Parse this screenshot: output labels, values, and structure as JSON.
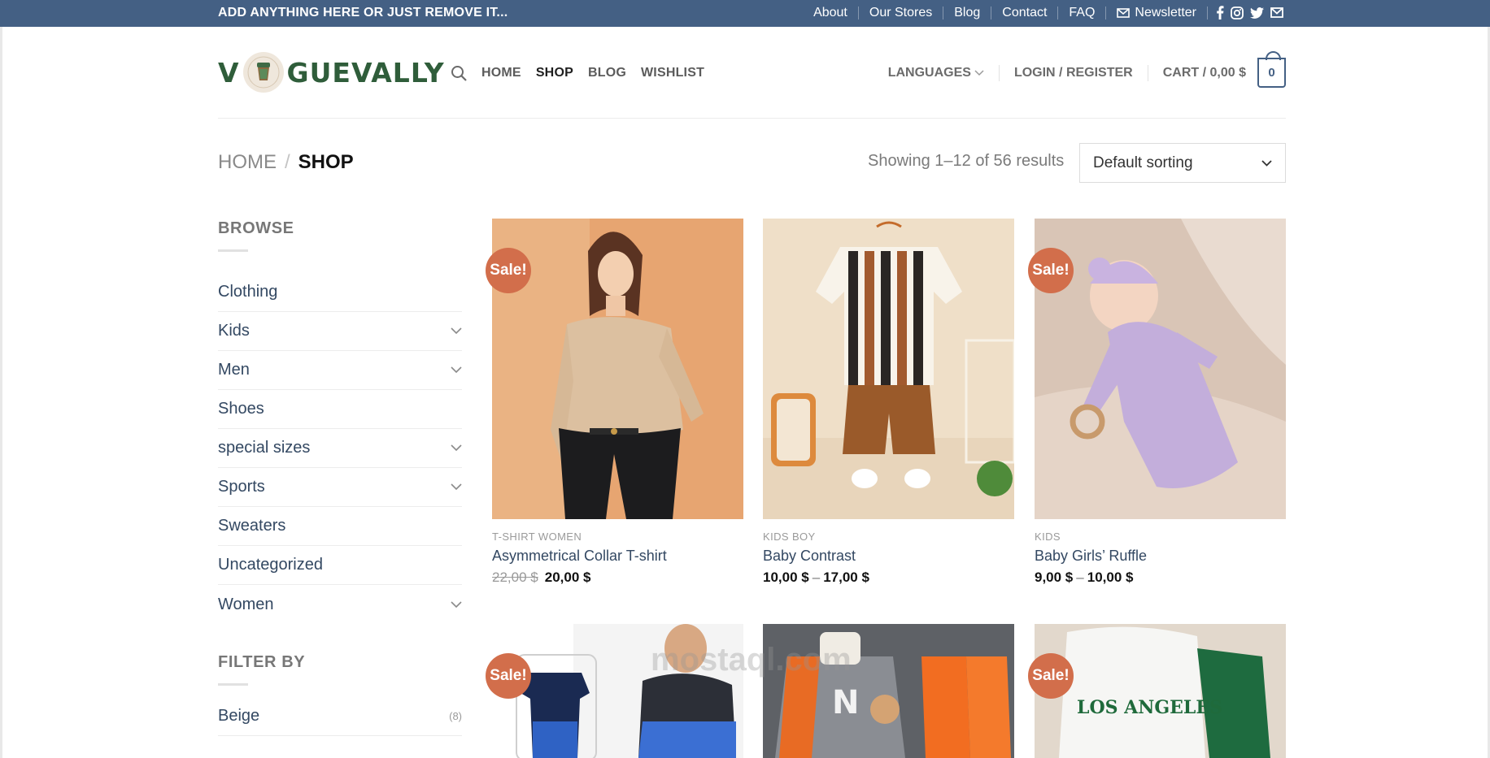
{
  "topbar": {
    "message": "ADD ANYTHING HERE OR JUST REMOVE IT...",
    "links": [
      "About",
      "Our Stores",
      "Blog",
      "Contact",
      "FAQ"
    ],
    "newsletter": "Newsletter",
    "social": [
      "facebook-icon",
      "instagram-icon",
      "twitter-icon",
      "email-icon"
    ]
  },
  "header": {
    "logo_left": "V",
    "logo_right": "GUEVALLY",
    "nav": [
      "HOME",
      "SHOP",
      "BLOG",
      "WISHLIST"
    ],
    "active_nav": "SHOP",
    "languages": "LANGUAGES",
    "login": "LOGIN / REGISTER",
    "cart_label": "CART / 0,00 $",
    "cart_count": "0"
  },
  "breadcrumb": {
    "home": "HOME",
    "separator": "/",
    "current": "SHOP"
  },
  "results_text": "Showing 1–12 of 56 results",
  "sort": {
    "selected": "Default sorting"
  },
  "sidebar": {
    "browse_title": "BROWSE",
    "categories": [
      {
        "label": "Clothing",
        "expandable": false
      },
      {
        "label": "Kids",
        "expandable": true
      },
      {
        "label": "Men",
        "expandable": true
      },
      {
        "label": "Shoes",
        "expandable": false
      },
      {
        "label": "special sizes",
        "expandable": true
      },
      {
        "label": "Sports",
        "expandable": true
      },
      {
        "label": "Sweaters",
        "expandable": false
      },
      {
        "label": "Uncategorized",
        "expandable": false
      },
      {
        "label": "Women",
        "expandable": true
      }
    ],
    "filter_title": "FILTER BY",
    "filters": [
      {
        "label": "Beige",
        "count": "(8)"
      }
    ]
  },
  "products": [
    {
      "category": "T-SHIRT WOMEN",
      "name": "Asymmetrical Collar T-shirt",
      "old_price": "22,00 $",
      "price": "20,00 $",
      "sale": "Sale!"
    },
    {
      "category": "KIDS BOY",
      "name": "Baby Contrast",
      "price_from": "10,00 $",
      "price_to": "17,00 $"
    },
    {
      "category": "KIDS",
      "name": "Baby Girls’ Ruffle",
      "price_from": "9,00 $",
      "price_to": "10,00 $",
      "sale": "Sale!"
    },
    {
      "sale": "Sale!"
    },
    {},
    {
      "sale": "Sale!",
      "print": "LOS ANGELES"
    }
  ],
  "watermark": "mostaql.com",
  "colors": {
    "topbar": "#446084",
    "sale": "#d26e4b",
    "link": "#334862"
  }
}
